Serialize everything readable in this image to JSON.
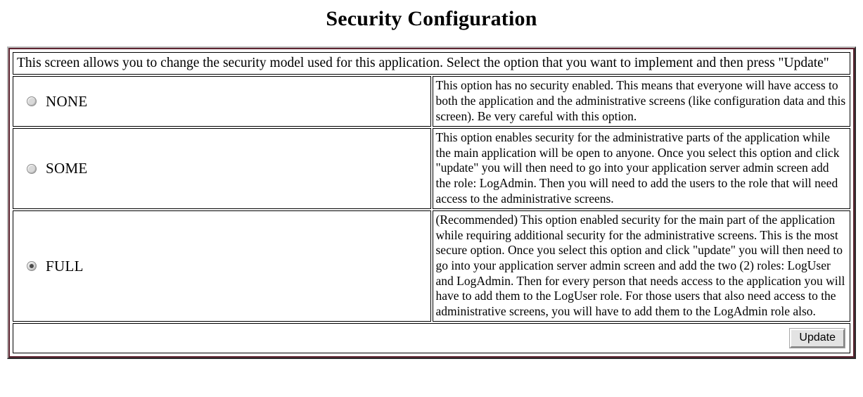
{
  "page": {
    "title": "Security Configuration"
  },
  "intro": {
    "text": "This screen allows you to change the security model used for this application. Select the option that you want to implement and then press \"Update\""
  },
  "options": [
    {
      "id": "none",
      "label": "NONE",
      "selected": false,
      "description": "This option has no security enabled. This means that everyone will have access to both the application and the administrative screens (like configuration data and this screen). Be very careful with this option."
    },
    {
      "id": "some",
      "label": "SOME",
      "selected": false,
      "description": "This option enables security for the administrative parts of the application while the main application will be open to anyone. Once you select this option and click \"update\" you will then need to go into your application server admin screen add the role: LogAdmin. Then you will need to add the users to the role that will need access to the administrative screens."
    },
    {
      "id": "full",
      "label": "FULL",
      "selected": true,
      "description": "(Recommended) This option enabled security for the main part of the application while requiring additional security for the administrative screens. This is the most secure option. Once you select this option and click \"update\" you will then need to go into your application server admin screen and add the two (2) roles: LogUser and LogAdmin. Then for every person that needs access to the application you will have to add them to the LogUser role. For those users that also need access to the administrative screens, you will have to add them to the LogAdmin role also."
    }
  ],
  "footer": {
    "update_label": "Update"
  },
  "colors": {
    "panel_header_bg": "#dedede",
    "frame_accent": "#5e2430",
    "page_bg": "#ffffff",
    "text": "#000000"
  }
}
